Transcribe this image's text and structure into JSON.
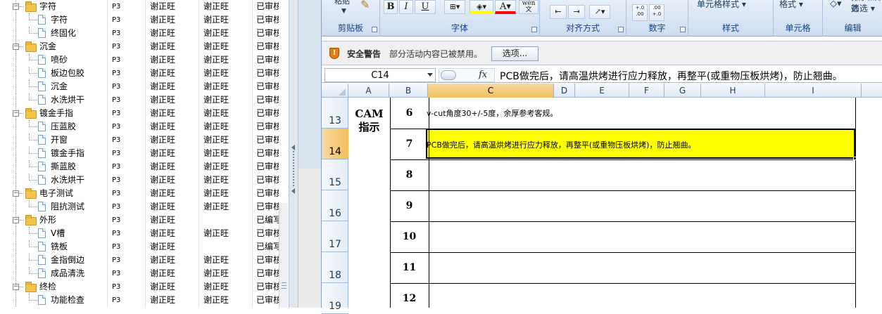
{
  "tree": {
    "rows": [
      {
        "label": "字符",
        "type": "folder",
        "code": "P3",
        "user1": "谢正旺",
        "user2": "谢正旺",
        "status": "已审核"
      },
      {
        "label": "字符",
        "type": "item",
        "code": "P3",
        "user1": "谢正旺",
        "user2": "谢正旺",
        "status": "已审核"
      },
      {
        "label": "终固化",
        "type": "item",
        "code": "P3",
        "user1": "谢正旺",
        "user2": "谢正旺",
        "status": "已审核"
      },
      {
        "label": "沉金",
        "type": "folder",
        "code": "P3",
        "user1": "谢正旺",
        "user2": "谢正旺",
        "status": "已审核"
      },
      {
        "label": "喷砂",
        "type": "item",
        "code": "P3",
        "user1": "谢正旺",
        "user2": "谢正旺",
        "status": "已审核"
      },
      {
        "label": "板边包胶",
        "type": "item",
        "code": "P3",
        "user1": "谢正旺",
        "user2": "谢正旺",
        "status": "已审核"
      },
      {
        "label": "沉金",
        "type": "item",
        "code": "P3",
        "user1": "谢正旺",
        "user2": "谢正旺",
        "status": "已审核"
      },
      {
        "label": "水洗烘干",
        "type": "item",
        "code": "P3",
        "user1": "谢正旺",
        "user2": "谢正旺",
        "status": "已审核"
      },
      {
        "label": "镀金手指",
        "type": "folder",
        "code": "P3",
        "user1": "谢正旺",
        "user2": "谢正旺",
        "status": "已审核"
      },
      {
        "label": "压蓝胶",
        "type": "item",
        "code": "P3",
        "user1": "谢正旺",
        "user2": "谢正旺",
        "status": "已审核"
      },
      {
        "label": "开窗",
        "type": "item",
        "code": "P3",
        "user1": "谢正旺",
        "user2": "谢正旺",
        "status": "已审核"
      },
      {
        "label": "镀金手指",
        "type": "item",
        "code": "P3",
        "user1": "谢正旺",
        "user2": "谢正旺",
        "status": "已审核"
      },
      {
        "label": "撕蓝胶",
        "type": "item",
        "code": "P3",
        "user1": "谢正旺",
        "user2": "谢正旺",
        "status": "已审核"
      },
      {
        "label": "水洗烘干",
        "type": "item",
        "code": "P3",
        "user1": "谢正旺",
        "user2": "谢正旺",
        "status": "已审核"
      },
      {
        "label": "电子测试",
        "type": "folder",
        "code": "P3",
        "user1": "谢正旺",
        "user2": "谢正旺",
        "status": "已审核"
      },
      {
        "label": "阻抗测试",
        "type": "item",
        "code": "P3",
        "user1": "谢正旺",
        "user2": "谢正旺",
        "status": "已审核"
      },
      {
        "label": "外形",
        "type": "folder",
        "code": "P3",
        "user1": "谢正旺",
        "user2": "",
        "status": "已编写"
      },
      {
        "label": "V槽",
        "type": "item",
        "code": "P3",
        "user1": "谢正旺",
        "user2": "谢正旺",
        "status": "已审核"
      },
      {
        "label": "铣板",
        "type": "item",
        "code": "P3",
        "user1": "谢正旺",
        "user2": "",
        "status": "已编写"
      },
      {
        "label": "金指倒边",
        "type": "item",
        "code": "P3",
        "user1": "谢正旺",
        "user2": "谢正旺",
        "status": "已审核"
      },
      {
        "label": "成品清洗",
        "type": "item",
        "code": "P3",
        "user1": "谢正旺",
        "user2": "谢正旺",
        "status": "已审核"
      },
      {
        "label": "终检",
        "type": "folder",
        "code": "P3",
        "user1": "谢正旺",
        "user2": "谢正旺",
        "status": "已审核"
      },
      {
        "label": "功能检查",
        "type": "item",
        "code": "P3",
        "user1": "谢正旺",
        "user2": "谢正旺",
        "status": "已审核"
      }
    ]
  },
  "ribbon": {
    "groups": {
      "clipboard": "剪贴板",
      "font": "字体",
      "alignment": "对齐方式",
      "number": "数字",
      "styles": "样式",
      "cells": "单元格",
      "editing": "编辑"
    },
    "paste_label": "粘贴",
    "bold": "B",
    "italic": "I",
    "underline": "U",
    "phonetic": "wén",
    "increase_decimal": "+.0 .00",
    "decrease_decimal": ".00 +.0",
    "cell_styles": "单元格样式",
    "format": "格式",
    "sort_filter": "排序和筛选",
    "filter_short": "筛选"
  },
  "security_bar": {
    "title": "安全警告",
    "message": "部分活动内容已被禁用。",
    "options_button": "选项..."
  },
  "formula_bar": {
    "name_box": "C14",
    "fx": "fx",
    "content": "PCB做完后，请高温烘烤进行应力释放，再整平(或重物压板烘烤)，防止翘曲。"
  },
  "sheet": {
    "columns": [
      "A",
      "B",
      "C",
      "D",
      "E",
      "F",
      "G",
      "H",
      "I"
    ],
    "selected_column": "C",
    "rows": [
      "13",
      "14",
      "15",
      "16",
      "17",
      "18",
      "19"
    ],
    "selected_row": "14",
    "section_label": "CAM\n指示",
    "numbers": [
      "6",
      "7",
      "8",
      "9",
      "10",
      "11",
      "12"
    ],
    "notes": {
      "row13": "v-cut角度30+/-5度，余厚参考客规。",
      "row14": "PCB做完后，请高温烘烤进行应力释放，再整平(或重物压板烘烤)，防止翘曲。"
    },
    "selected_fill": "#ffff00"
  }
}
